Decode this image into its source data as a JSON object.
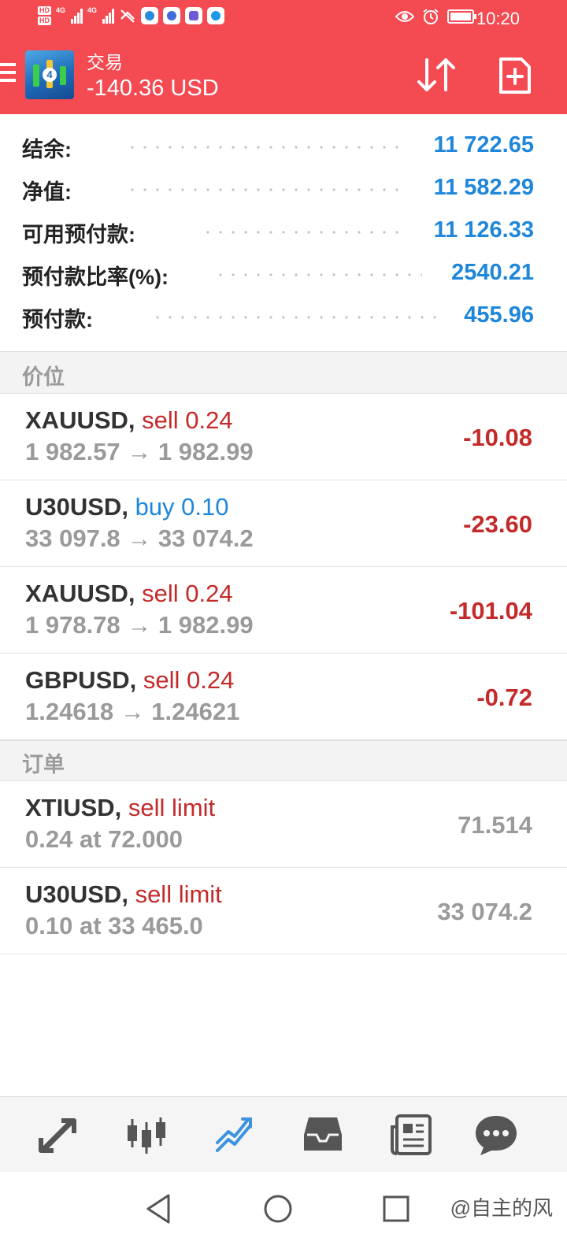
{
  "status_bar": {
    "hd_top": "HD",
    "hd_bottom": "HD",
    "net1": "4G",
    "net2": "4G",
    "time": "10:20"
  },
  "header": {
    "title": "交易",
    "profit": "-140.36 USD",
    "logo_number": "4"
  },
  "account": [
    {
      "label": "结余:",
      "value": "11 722.65"
    },
    {
      "label": "净值:",
      "value": "11 582.29"
    },
    {
      "label": "可用预付款:",
      "value": "11 126.33"
    },
    {
      "label": "预付款比率(%):",
      "value": "2540.21"
    },
    {
      "label": "预付款:",
      "value": "455.96"
    }
  ],
  "positions_header": "价位",
  "positions": [
    {
      "symbol": "XAUUSD,",
      "action": "sell 0.24",
      "side": "sell",
      "prices": "1 982.57 → 1 982.99",
      "pnl": "-10.08"
    },
    {
      "symbol": "U30USD,",
      "action": "buy 0.10",
      "side": "buy",
      "prices": "33 097.8 → 33 074.2",
      "pnl": "-23.60"
    },
    {
      "symbol": "XAUUSD,",
      "action": "sell 0.24",
      "side": "sell",
      "prices": "1 978.78 → 1 982.99",
      "pnl": "-101.04"
    },
    {
      "symbol": "GBPUSD,",
      "action": "sell 0.24",
      "side": "sell",
      "prices": "1.24618 → 1.24621",
      "pnl": "-0.72"
    }
  ],
  "orders_header": "订单",
  "orders": [
    {
      "symbol": "XTIUSD,",
      "action": "sell limit",
      "detail": "0.24 at 72.000",
      "price": "71.514"
    },
    {
      "symbol": "U30USD,",
      "action": "sell limit",
      "detail": "0.10 at 33 465.0",
      "price": "33 074.2"
    }
  ],
  "bottom_nav": [
    {
      "name": "quotes",
      "icon": "quotes-arrows-icon",
      "active": false
    },
    {
      "name": "chart",
      "icon": "candlestick-icon",
      "active": false
    },
    {
      "name": "trade",
      "icon": "trade-trend-icon",
      "active": true
    },
    {
      "name": "history",
      "icon": "inbox-tray-icon",
      "active": false
    },
    {
      "name": "news",
      "icon": "newspaper-icon",
      "active": false
    },
    {
      "name": "chat",
      "icon": "chat-bubble-icon",
      "active": false
    }
  ],
  "watermark": "@自主的风",
  "colors": {
    "header_red": "#f44a52",
    "value_blue": "#1f87db",
    "loss_red": "#c42a2a",
    "muted_gray": "#9a9a9a",
    "active_nav": "#3d93e0",
    "inactive_nav": "#555555"
  }
}
